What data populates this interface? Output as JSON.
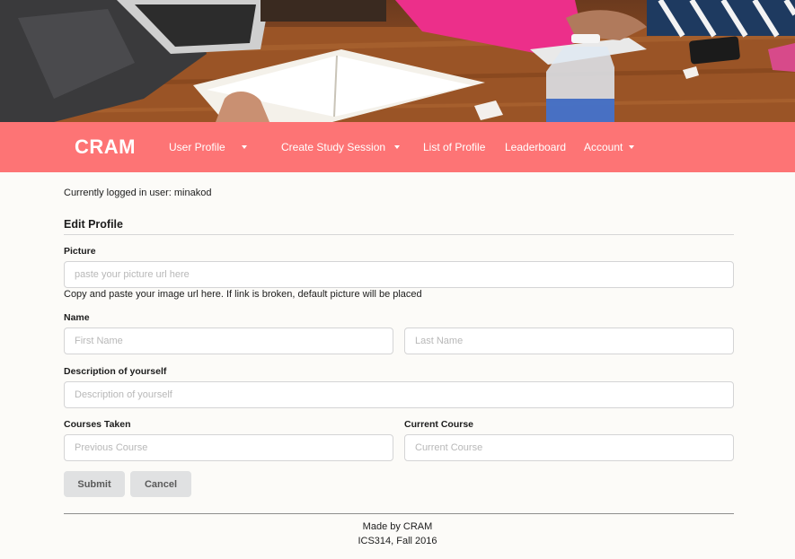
{
  "navbar": {
    "brand": "CRAM",
    "items": [
      {
        "label": "User Profile",
        "has_dropdown": true
      },
      {
        "label": "Create Study Session",
        "has_dropdown": true
      },
      {
        "label": "List of Profile",
        "has_dropdown": false
      },
      {
        "label": "Leaderboard",
        "has_dropdown": false
      },
      {
        "label": "Account",
        "has_dropdown": true
      }
    ]
  },
  "user": {
    "logged_in_text": "Currently logged in user: minakod"
  },
  "form": {
    "title": "Edit Profile",
    "picture": {
      "label": "Picture",
      "placeholder": "paste your picture url here",
      "value": "",
      "help": "Copy and paste your image url here. If link is broken, default picture will be placed"
    },
    "name": {
      "label": "Name",
      "first_placeholder": "First Name",
      "last_placeholder": "Last Name",
      "first_value": "",
      "last_value": ""
    },
    "description": {
      "label": "Description of yourself",
      "placeholder": "Description of yourself",
      "value": ""
    },
    "courses_taken": {
      "label": "Courses Taken",
      "placeholder": "Previous Course",
      "value": ""
    },
    "current_course": {
      "label": "Current Course",
      "placeholder": "Current Course",
      "value": ""
    },
    "submit_label": "Submit",
    "cancel_label": "Cancel"
  },
  "footer": {
    "line1": "Made by CRAM",
    "line2": "ICS314, Fall 2016"
  },
  "colors": {
    "navbar": "#fd7475",
    "page_background": "#fcfbf8",
    "button": "#e0e1e2"
  }
}
